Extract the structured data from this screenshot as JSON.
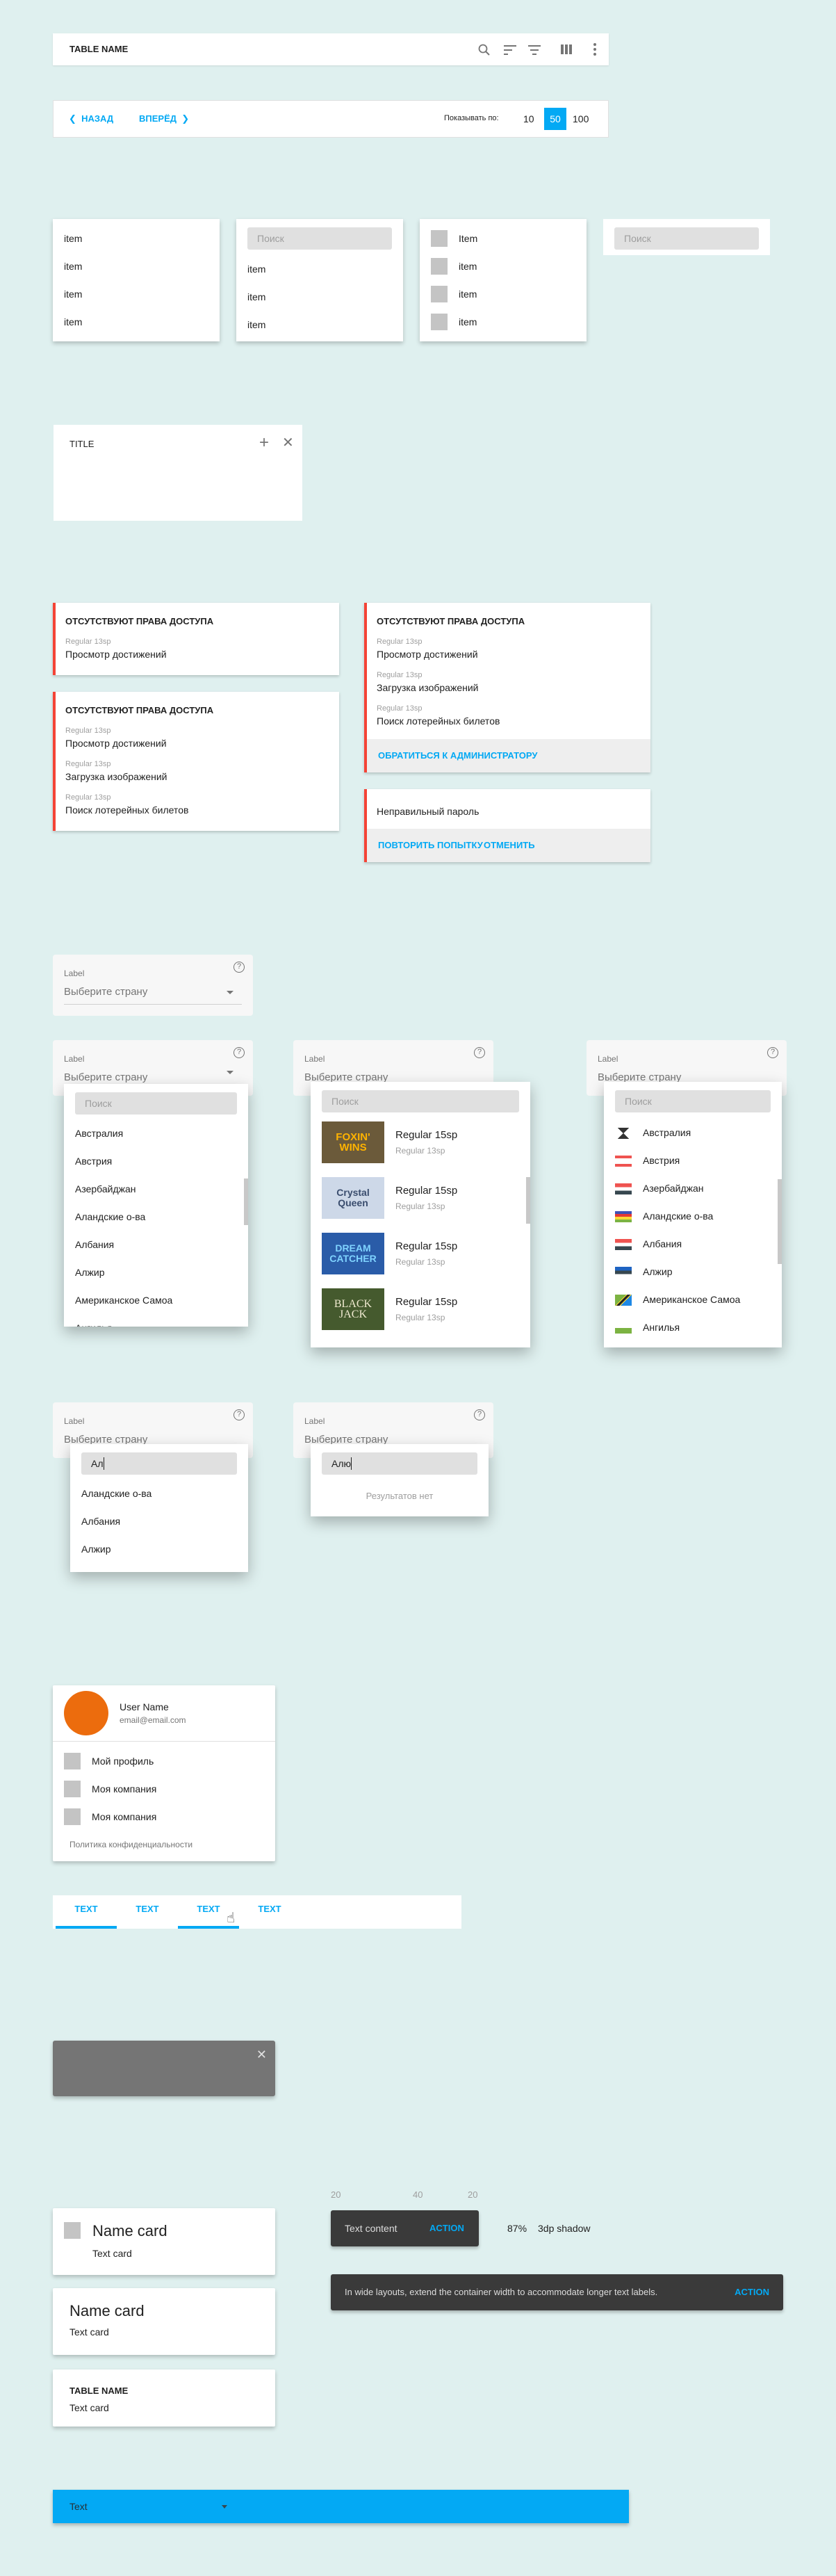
{
  "table_header": {
    "title": "TABLE NAME",
    "icons": [
      "search-icon",
      "sort-icon",
      "filter-icon",
      "columns-icon",
      "more-vert-icon"
    ]
  },
  "pagination": {
    "back": "НАЗАД",
    "forward": "ВПЕРЁД",
    "per_page_label": "Показывать по:",
    "options": [
      "10",
      "50",
      "100"
    ],
    "selected": "50"
  },
  "menus": {
    "simple": [
      "item",
      "item",
      "item",
      "item"
    ],
    "search_placeholder": "Поиск",
    "with_search": [
      "item",
      "item",
      "item"
    ],
    "with_icons": [
      "Item",
      "item",
      "item",
      "item"
    ]
  },
  "dialog": {
    "title": "TITLE"
  },
  "alerts": {
    "title": "ОТСУТСТВУЮТ ПРАВА ДОСТУПА",
    "label": "Regular 13sp",
    "rights": [
      "Просмотр достижений",
      "Загрузка изображений",
      "Поиск лотерейных билетов"
    ],
    "contact_admin": "ОБРАТИТЬСЯ К АДМИНИСТРАТОРУ",
    "wrong_password": "Неправильный пароль",
    "retry": "ПОВТОРИТЬ ПОПЫТКУ",
    "cancel": "ОТМЕНИТЬ"
  },
  "select": {
    "label": "Label",
    "placeholder": "Выберите страну",
    "search_placeholder": "Поиск",
    "countries": [
      "Австралия",
      "Австрия",
      "Азербайджан",
      "Аландские о-ва",
      "Албания",
      "Алжир",
      "Американское Самоа",
      "Ангилья"
    ],
    "games": [
      {
        "title": "Regular 15sp",
        "subtitle": "Regular 13sp",
        "logo": "FOXIN' WINS"
      },
      {
        "title": "Regular 15sp",
        "subtitle": "Regular 13sp",
        "logo": "Crystal Queen"
      },
      {
        "title": "Regular 15sp",
        "subtitle": "Regular 13sp",
        "logo": "DREAM CATCHER"
      },
      {
        "title": "Regular 15sp",
        "subtitle": "Regular 13sp",
        "logo": "BLACK JACK"
      }
    ],
    "filter_query": "Ал",
    "filter_results": [
      "Аландские о-ва",
      "Албания",
      "Алжир"
    ],
    "no_match_query": "Алю",
    "no_results": "Результатов нет"
  },
  "profile": {
    "name": "User Name",
    "email": "email@email.com",
    "avatar_color": "#ec6c0d",
    "items": [
      "Мой профиль",
      "Моя компания",
      "Моя компания"
    ],
    "policy": "Политика конфиденциальности"
  },
  "tabs": {
    "items": [
      "TEXT",
      "TEXT",
      "TEXT",
      "TEXT"
    ],
    "active": [
      0,
      2
    ]
  },
  "snackbar": {
    "spacing": [
      "20",
      "40",
      "20"
    ],
    "text": "Text content",
    "action": "ACTION",
    "opacity_note": "87%",
    "shadow_note": "3dp shadow",
    "wide_text": "In wide layouts, extend the container width to accommodate longer text labels.",
    "wide_action": "ACTION"
  },
  "cards": {
    "name": "Name card",
    "text": "Text card",
    "table_name": "TABLE NAME"
  },
  "bar_select": {
    "value": "Text"
  },
  "colors": {
    "accent": "#03a9f4",
    "error": "#f44336",
    "background": "#dff0ef",
    "snackbar": "#3a3a3a",
    "toast": "#757575"
  }
}
